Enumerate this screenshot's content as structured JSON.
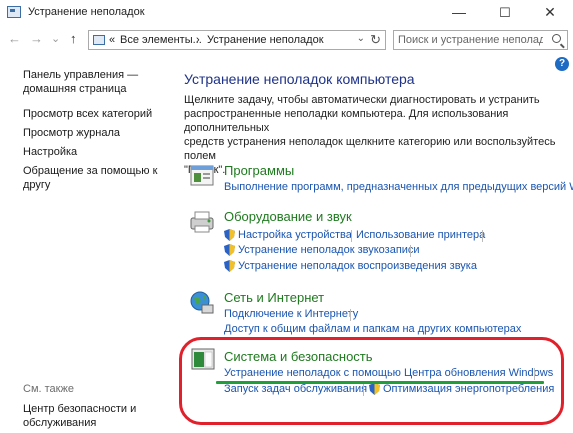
{
  "window": {
    "title": "Устранение неполадок",
    "minimize": "—",
    "maximize": "☐",
    "close": "✕"
  },
  "nav": {
    "back": "←",
    "forward": "→",
    "dropdown": "⌄",
    "up": "↑",
    "breadcrumb_sep1": "«",
    "crumb1": "Все элементы...",
    "crumb_sep": "›",
    "crumb2": "Устранение неполадок",
    "addr_dropdown": "⌄",
    "refresh": "↻",
    "search_placeholder": "Поиск и устранение неполад..."
  },
  "help": "?",
  "sidebar": {
    "home_line1": "Панель управления —",
    "home_line2": "домашняя страница",
    "items": [
      "Просмотр всех категорий",
      "Просмотр журнала",
      "Настройка"
    ],
    "help_line1": "Обращение за помощью к",
    "help_line2": "другу",
    "see_also": "См. также",
    "security_line1": "Центр безопасности и",
    "security_line2": "обслуживания"
  },
  "main": {
    "title": "Устранение неполадок компьютера",
    "desc_lines": [
      "Щелкните задачу, чтобы автоматически диагностировать и устранить",
      "распространенные неполадки компьютера. Для использования дополнительных",
      "средств устранения неполадок щелкните категорию или воспользуйтесь полем",
      "\"Поиск\"."
    ]
  },
  "categories": {
    "programs": {
      "title": "Программы",
      "links": [
        "Выполнение программ, предназначенных для предыдущих версий Wind"
      ]
    },
    "hardware": {
      "title": "Оборудование и звук",
      "links": [
        "Настройка устройства",
        "Использование принтера",
        "Устранение неполадок звукозаписи",
        "Устранение неполадок воспроизведения звука"
      ]
    },
    "network": {
      "title": "Сеть и Интернет",
      "links": [
        "Подключение к Интернету",
        "Доступ к общим файлам и папкам на других компьютерах"
      ]
    },
    "system": {
      "title": "Система и безопасность",
      "links": [
        "Устранение неполадок с помощью Центра обновления Windows",
        "Запуск задач обслуживания",
        "Оптимизация энергопотребления"
      ]
    }
  },
  "colors": {
    "link": "#1a55b0",
    "category_title": "#1f7a1f",
    "heading": "#1e3287",
    "highlight_oval": "#e0202a",
    "underline": "#1f9e3a"
  }
}
